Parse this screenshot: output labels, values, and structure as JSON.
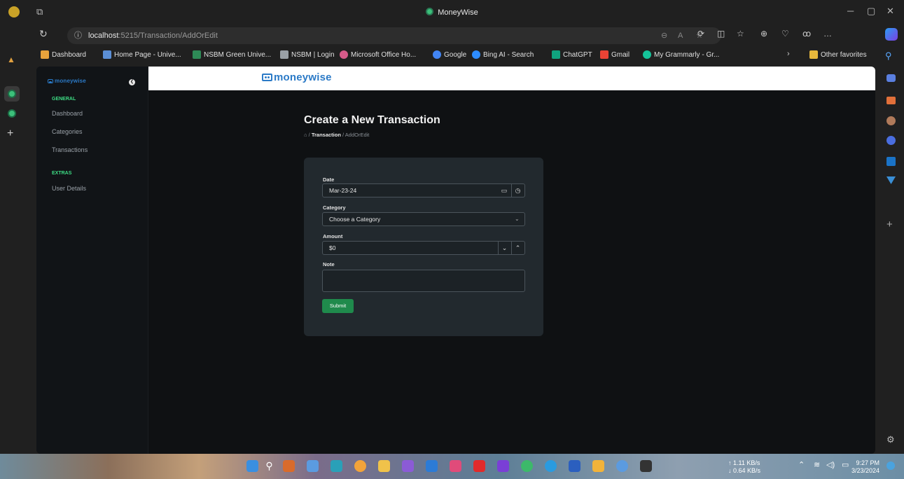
{
  "window": {
    "title": "MoneyWise"
  },
  "browser": {
    "url_host": "localhost",
    "url_rest": ":5215/Transaction/AddOrEdit",
    "favorites": [
      {
        "label": "Dashboard",
        "color": "#e8a33c"
      },
      {
        "label": "Home Page - Unive...",
        "color": "#5b8fd6"
      },
      {
        "label": "NSBM Green Unive...",
        "color": "#2e8b57"
      },
      {
        "label": "NSBM | Login",
        "color": "#9aa0a6"
      },
      {
        "label": "Microsoft Office Ho...",
        "color": "#d65b8a"
      },
      {
        "label": "Google",
        "color": "#4285f4"
      },
      {
        "label": "Bing AI - Search",
        "color": "#2d8cff"
      },
      {
        "label": "ChatGPT",
        "color": "#10a37f"
      },
      {
        "label": "Gmail",
        "color": "#ea4335"
      },
      {
        "label": "My Grammarly - Gr...",
        "color": "#15c39a"
      }
    ],
    "other_favorites": "Other favorites"
  },
  "app": {
    "brand": "moneywise",
    "sidebar": {
      "general_label": "GENERAL",
      "items": [
        {
          "label": "Dashboard"
        },
        {
          "label": "Categories"
        },
        {
          "label": "Transactions"
        }
      ],
      "extras_label": "EXTRAS",
      "extras_items": [
        {
          "label": "User Details"
        }
      ]
    },
    "page_title": "Create a New Transaction",
    "breadcrumb": {
      "sep": "/",
      "section": "Transaction",
      "current": "AddOrEdit"
    },
    "form": {
      "date_label": "Date",
      "date_value": "Mar-23-24",
      "category_label": "Category",
      "category_value": "Choose a Category",
      "amount_label": "Amount",
      "amount_value": "$0",
      "note_label": "Note",
      "note_value": "",
      "submit_label": "Submit"
    }
  },
  "taskbar": {
    "net_up": "↑ 1.11 KB/s",
    "net_down": "↓ 0.64 KB/s",
    "time": "9:27 PM",
    "date": "3/23/2024"
  },
  "colors": {
    "accent": "#3ddc84",
    "brand": "#2b7ac7",
    "submit": "#1f8a4c"
  }
}
